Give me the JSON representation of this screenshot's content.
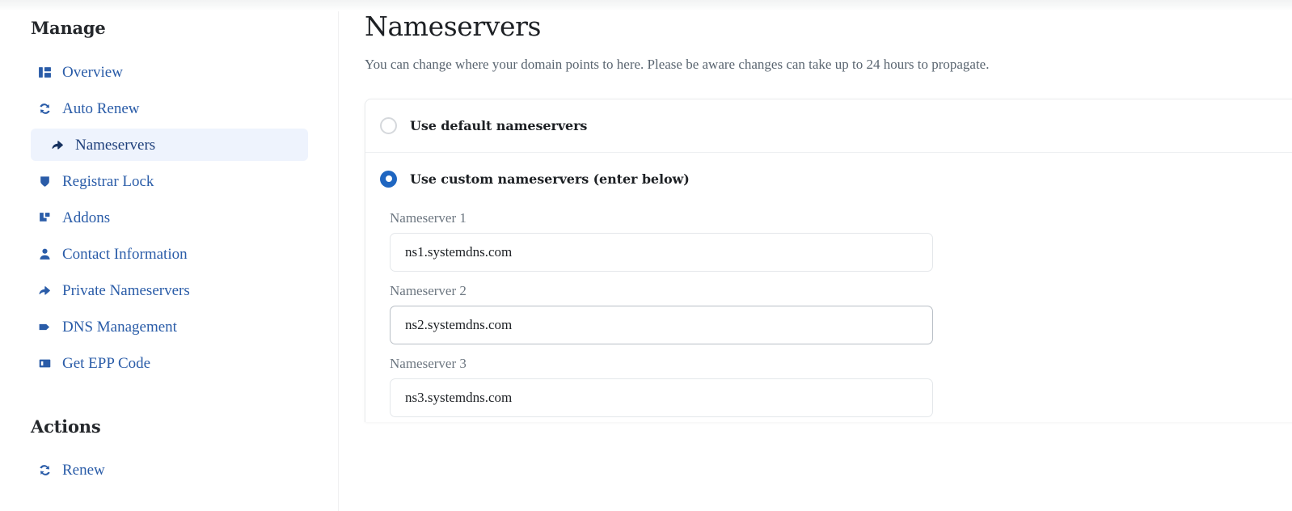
{
  "sidebar": {
    "manage_heading": "Manage",
    "actions_heading": "Actions",
    "manage_items": [
      {
        "label": "Overview",
        "icon": "layout-columns-icon",
        "active": false
      },
      {
        "label": "Auto Renew",
        "icon": "refresh-sync-icon",
        "active": false
      },
      {
        "label": "Nameservers",
        "icon": "arrow-right-curved-icon",
        "active": true
      },
      {
        "label": "Registrar Lock",
        "icon": "shield-icon",
        "active": false
      },
      {
        "label": "Addons",
        "icon": "addons-blocks-icon",
        "active": false
      },
      {
        "label": "Contact Information",
        "icon": "user-icon",
        "active": false
      },
      {
        "label": "Private Nameservers",
        "icon": "arrow-right-curved-icon",
        "active": false
      },
      {
        "label": "DNS Management",
        "icon": "tag-icon",
        "active": false
      },
      {
        "label": "Get EPP Code",
        "icon": "epp-code-icon",
        "active": false
      }
    ],
    "actions_items": [
      {
        "label": "Renew",
        "icon": "refresh-sync-icon",
        "active": false
      }
    ]
  },
  "main": {
    "title": "Nameservers",
    "subtitle": "You can change where your domain points to here. Please be aware changes can take up to 24 hours to propagate.",
    "options": [
      {
        "label": "Use default nameservers",
        "selected": false
      },
      {
        "label": "Use custom nameservers (enter below)",
        "selected": true
      }
    ],
    "nameserver_fields": [
      {
        "label": "Nameserver 1",
        "value": "ns1.systemdns.com",
        "placeholder": "",
        "hovered": false
      },
      {
        "label": "Nameserver 2",
        "value": "ns2.systemdns.com",
        "placeholder": "",
        "hovered": true
      },
      {
        "label": "Nameserver 3",
        "value": "ns3.systemdns.com",
        "placeholder": "",
        "hovered": false
      }
    ]
  },
  "colors": {
    "link_blue": "#2a5ca8",
    "active_bg": "#eef3fd",
    "active_text": "#1e3f7a",
    "radio_blue": "#1f66c1",
    "heading_text": "#1d2024",
    "muted_text": "#6c7680"
  }
}
